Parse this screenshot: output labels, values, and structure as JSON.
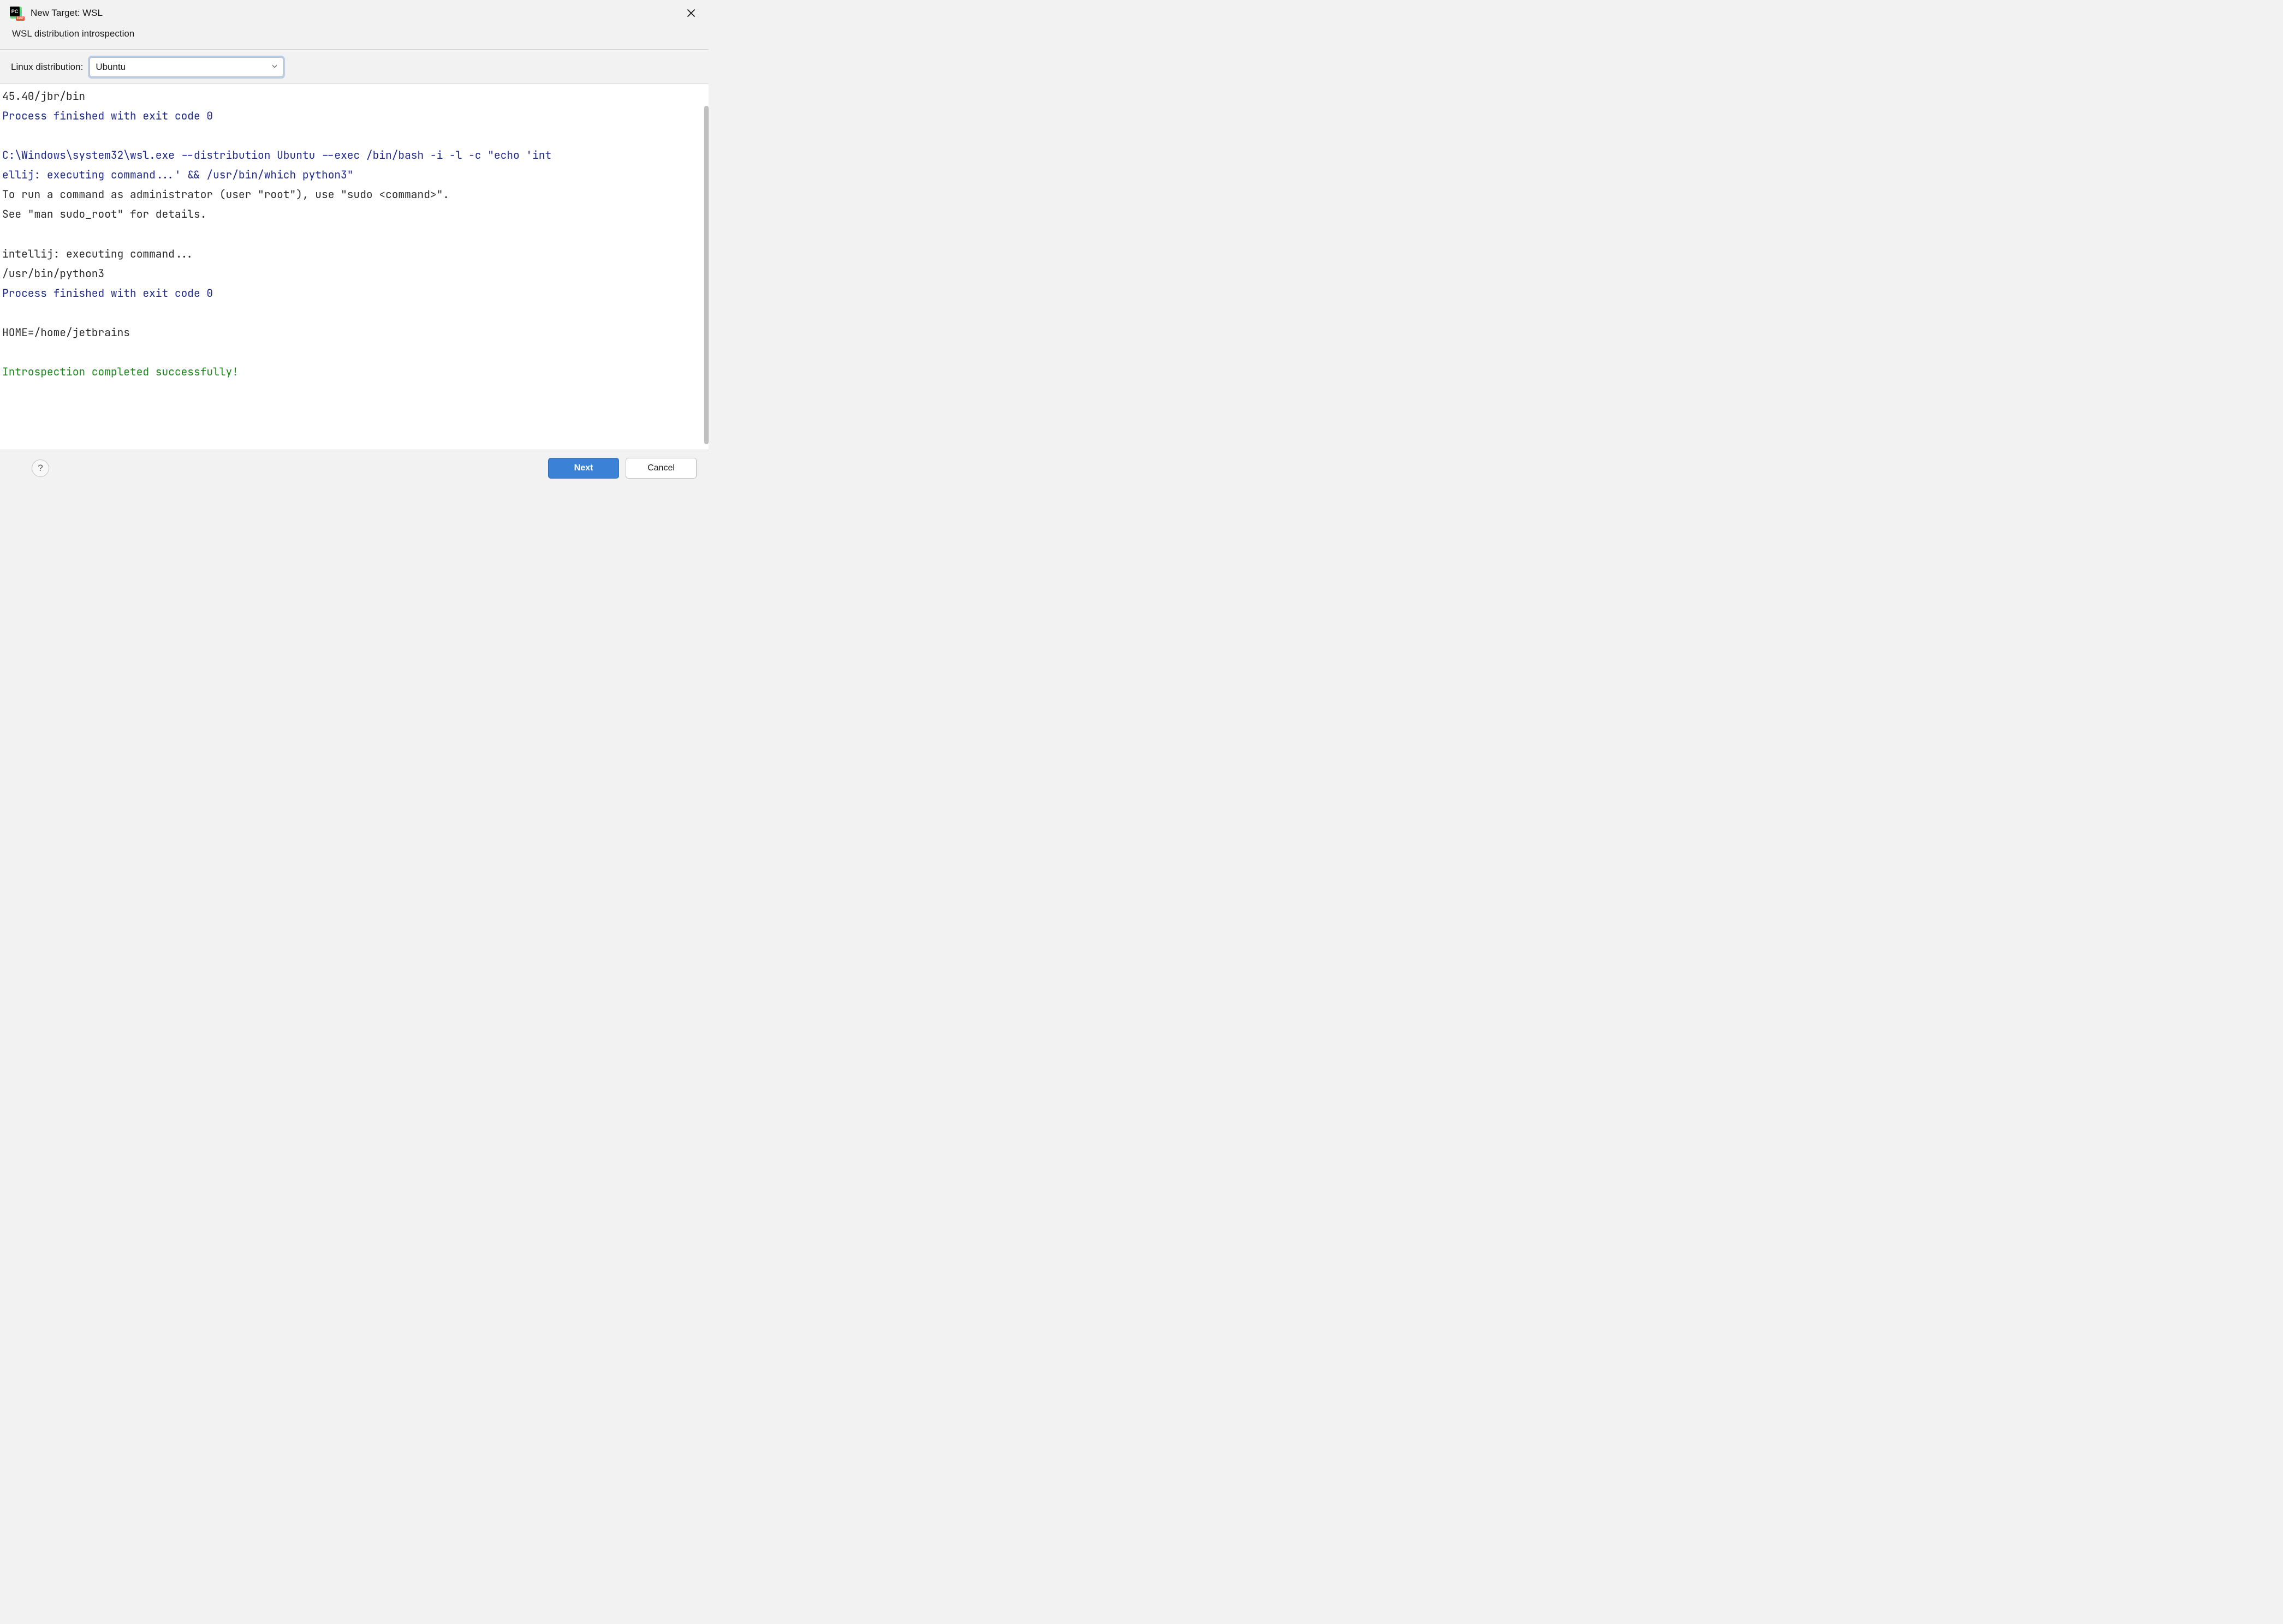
{
  "titleBar": {
    "title": "New Target: WSL",
    "appIconPC": "PC",
    "appIconEAP": "EAP"
  },
  "subtitle": "WSL distribution introspection",
  "form": {
    "distroLabel": "Linux distribution:",
    "distroValue": "Ubuntu"
  },
  "console": {
    "line1": "45.40/jbr/bin",
    "line2": "Process finished with exit code 0",
    "cmd1a": "C:\\Windows\\system32\\wsl.exe --distribution Ubuntu --exec /bin/bash -i -l -c \"echo 'int",
    "cmd1b": "ellij: executing command...' && /usr/bin/which python3\"",
    "sudo1": "To run a command as administrator (user \"root\"), use \"sudo <command>\".",
    "sudo2": "See \"man sudo_root\" for details.",
    "exec": "intellij: executing command...",
    "python": "/usr/bin/python3",
    "exit2": "Process finished with exit code 0",
    "home": "HOME=/home/jetbrains",
    "success": "Introspection completed successfully!"
  },
  "footer": {
    "help": "?",
    "next": "Next",
    "cancel": "Cancel"
  }
}
